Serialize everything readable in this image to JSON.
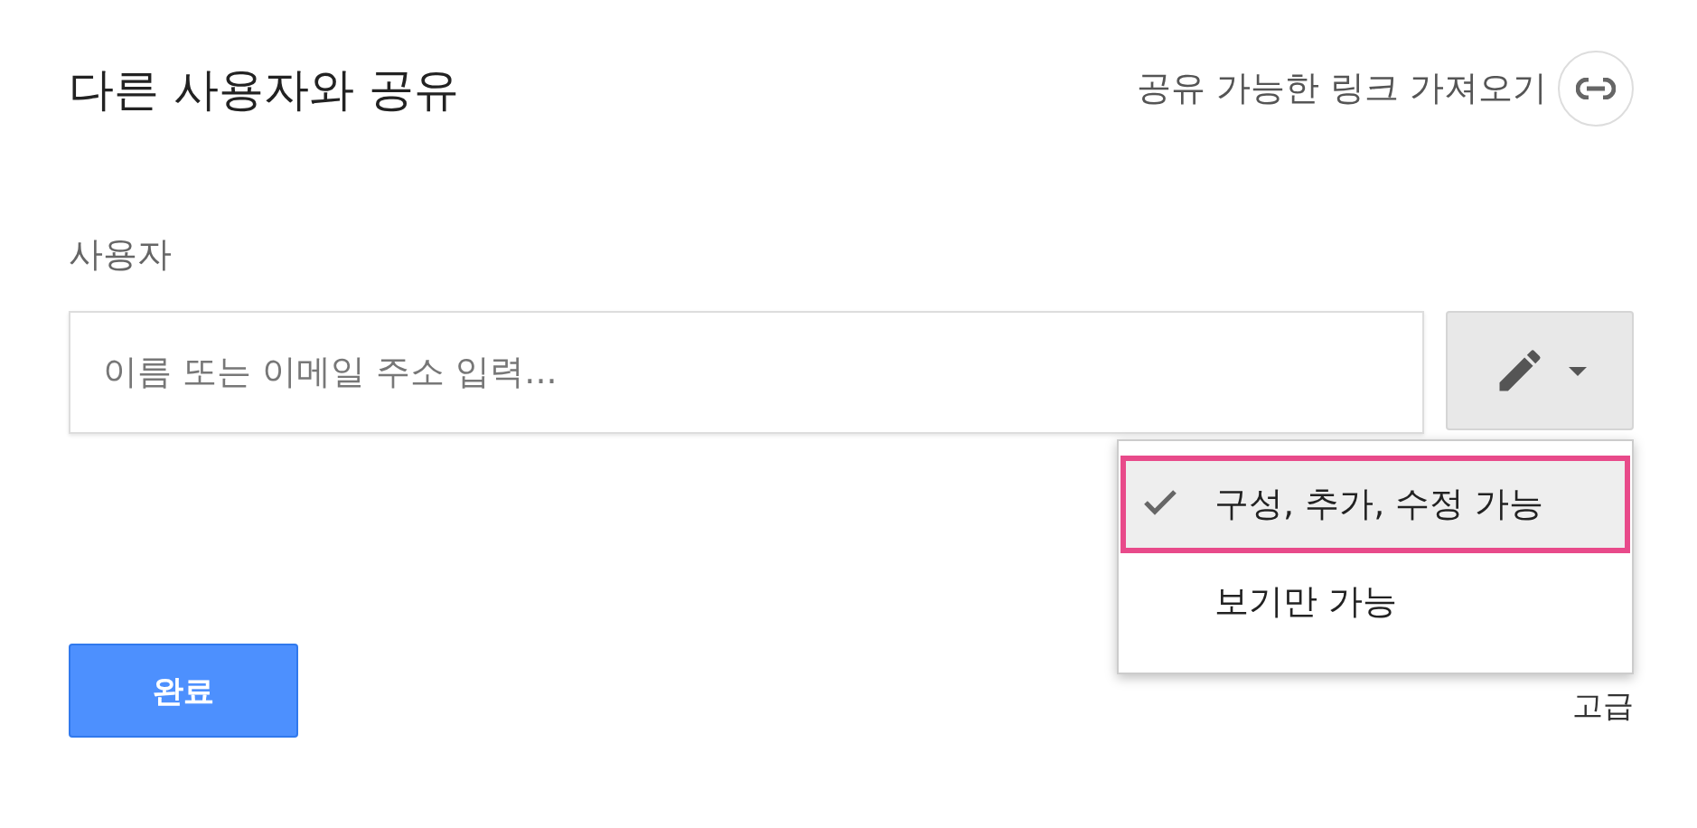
{
  "dialog": {
    "title": "다른 사용자와 공유",
    "link_label": "공유 가능한 링크 가져오기"
  },
  "people": {
    "label": "사용자",
    "placeholder": "이름 또는 이메일 주소 입력..."
  },
  "permission_menu": {
    "expanded": true,
    "items": [
      {
        "label": "구성, 추가, 수정 가능",
        "selected": true
      },
      {
        "label": "보기만 가능",
        "selected": false
      }
    ]
  },
  "buttons": {
    "done": "완료",
    "advanced": "고급"
  }
}
